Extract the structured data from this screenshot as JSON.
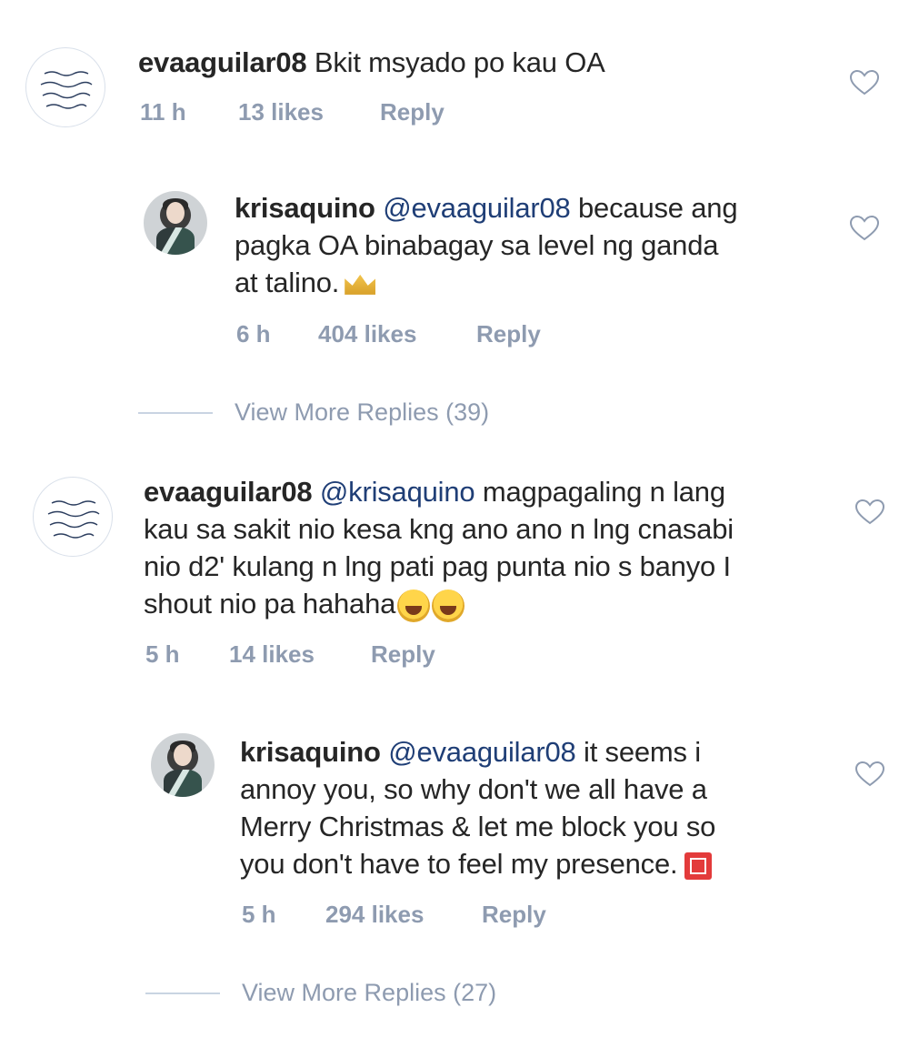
{
  "comments": [
    {
      "username": "evaaguilar08",
      "mention": "",
      "text": "Bkit msyado po kau OA",
      "time": "11 h",
      "likes": "13 likes",
      "reply_label": "Reply"
    },
    {
      "username": "krisaquino",
      "mention": "@evaaguilar08",
      "text_line1": "because ang",
      "text_line2": "pagka OA binabagay sa level ng ganda",
      "text_line3": "at talino.",
      "emoji": "crown",
      "time": "6 h",
      "likes": "404 likes",
      "reply_label": "Reply"
    },
    {
      "username": "evaaguilar08",
      "mention": "@krisaquino",
      "text_line1": "magpagaling n lang",
      "text_line2": "kau sa sakit nio kesa kng ano ano n lng cnasabi",
      "text_line3": "nio d2' kulang n lng pati pag punta nio s banyo I",
      "text_line4": "shout nio pa hahaha",
      "emoji": "grinning-squinting-face",
      "time": "5 h",
      "likes": "14 likes",
      "reply_label": "Reply"
    },
    {
      "username": "krisaquino",
      "mention": "@evaaguilar08",
      "text_line1": "it seems i",
      "text_line2": "annoy you, so why don't we all have a",
      "text_line3": "Merry Christmas & let me block you so",
      "text_line4": "you don't have to feel my presence.",
      "emoji": "red-square",
      "time": "5 h",
      "likes": "294 likes",
      "reply_label": "Reply"
    }
  ],
  "view_more": [
    {
      "label": "View More Replies (39)"
    },
    {
      "label": "View More Replies (27)"
    }
  ],
  "icons": {
    "like": "heart-outline-icon"
  },
  "colors": {
    "mention": "#1f3e76",
    "meta": "#8e9bb0",
    "text": "#262626"
  }
}
